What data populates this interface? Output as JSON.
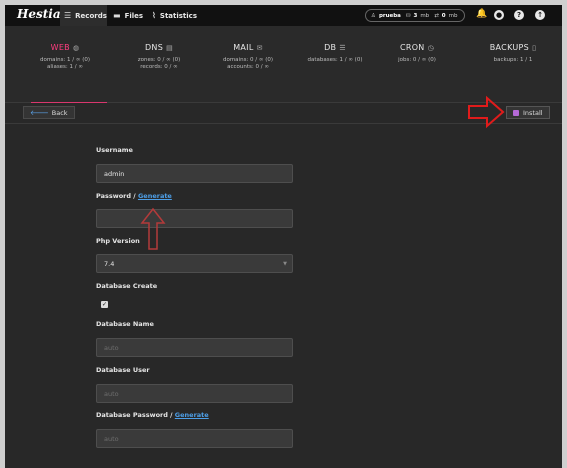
{
  "app": {
    "logo": "Hestia",
    "nav": [
      {
        "label": "Records",
        "icon": "list-icon"
      },
      {
        "label": "Files",
        "icon": "folder-icon"
      },
      {
        "label": "Statistics",
        "icon": "chart-icon"
      }
    ],
    "account": {
      "user": "prueba",
      "disk": "3",
      "disk_unit": "mb",
      "bandwidth": "0",
      "bw_unit": "mb"
    },
    "icons": [
      "bell-icon",
      "user-icon",
      "help-icon",
      "upload-icon"
    ]
  },
  "tabs": [
    {
      "title": "WEB",
      "line1": "domains: 1 / ∞ (0)",
      "line2": "aliases: 1 / ∞"
    },
    {
      "title": "DNS",
      "line1": "zones: 0 / ∞ (0)",
      "line2": "records: 0 / ∞"
    },
    {
      "title": "MAIL",
      "line1": "domains: 0 / ∞ (0)",
      "line2": "accounts: 0 / ∞"
    },
    {
      "title": "DB",
      "line1": "databases: 1 / ∞ (0)",
      "line2": ""
    },
    {
      "title": "CRON",
      "line1": "jobs: 0 / ∞ (0)",
      "line2": ""
    },
    {
      "title": "BACKUPS",
      "line1": "backups: 1 / 1",
      "line2": ""
    }
  ],
  "toolbar": {
    "back_label": "Back",
    "install_label": "Install"
  },
  "form": {
    "username_label": "Username",
    "username_value": "admin",
    "password_label": "Password / ",
    "generate_link": "Generate",
    "password_value": "",
    "php_label": "Php Version",
    "php_value": "7.4",
    "db_create_label": "Database Create",
    "db_name_label": "Database Name",
    "db_name_placeholder": "auto",
    "db_user_label": "Database User",
    "db_user_placeholder": "auto",
    "db_password_label": "Database Password / ",
    "db_password_generate": "Generate",
    "db_password_placeholder": "auto"
  },
  "colors": {
    "accent": "#ff3d7f",
    "link": "#4d9fe8",
    "annotation": "#e01b1b"
  }
}
